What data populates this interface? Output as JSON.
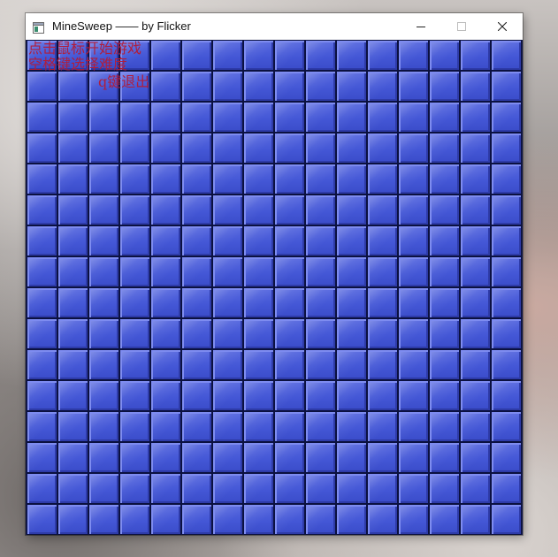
{
  "window": {
    "title": "MineSweep —— by Flicker",
    "controls": {
      "minimize_icon": "minimize-icon",
      "maximize_icon": "maximize-icon",
      "close_icon": "close-icon"
    }
  },
  "board": {
    "rows": 16,
    "cols": 16,
    "cell_state": "covered",
    "cell_color": "#4457d6",
    "grid_color": "#0b1140"
  },
  "instructions": {
    "line1": "点击鼠标开始游戏",
    "line2": "空格键选择难度",
    "line3": "q键退出",
    "color": "#b01e3c"
  }
}
